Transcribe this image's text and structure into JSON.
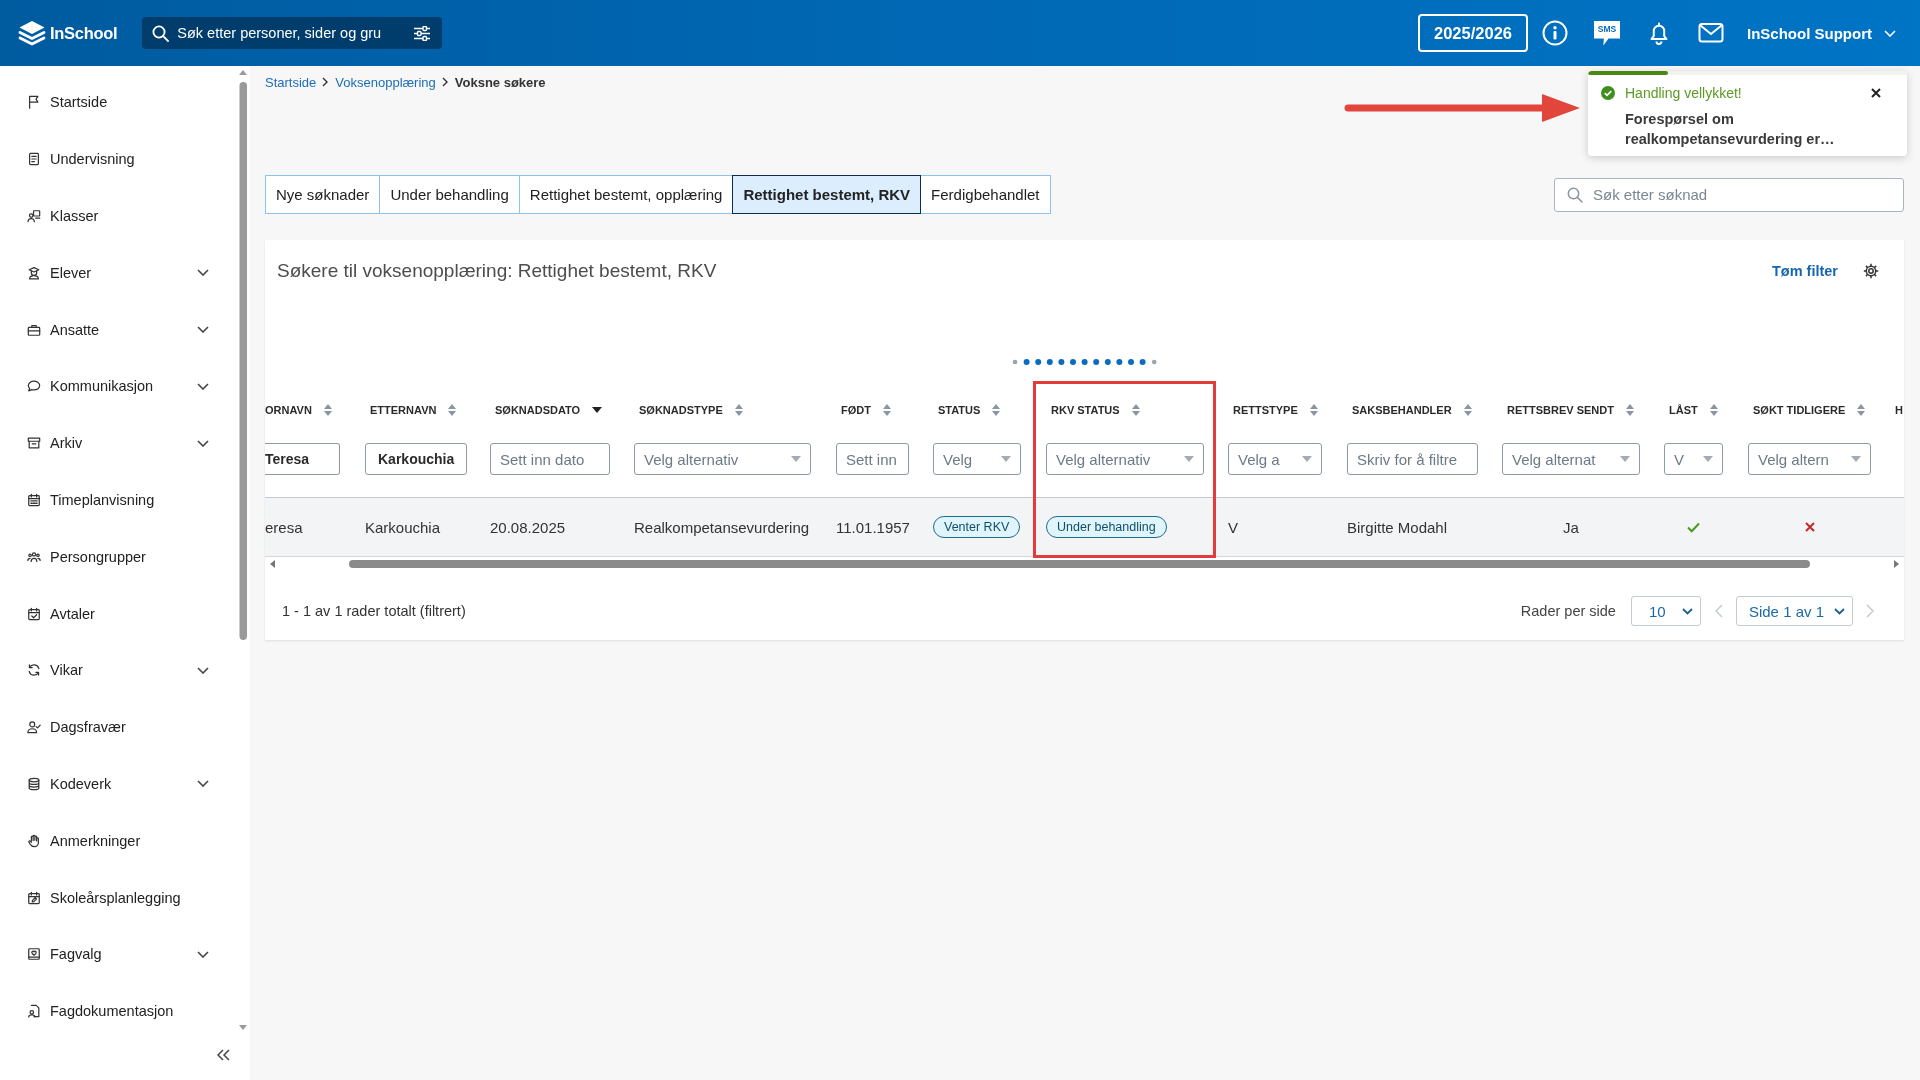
{
  "topbar": {
    "logo": "InSchool",
    "search": {
      "placeholder": "Søk etter personer, sider og gru"
    },
    "school_year": "2025/2026",
    "sms_label": "SMS",
    "user": "InSchool Support"
  },
  "sidebar": {
    "items": [
      {
        "label": "Startside",
        "expandable": false
      },
      {
        "label": "Undervisning",
        "expandable": false
      },
      {
        "label": "Klasser",
        "expandable": false
      },
      {
        "label": "Elever",
        "expandable": true
      },
      {
        "label": "Ansatte",
        "expandable": true
      },
      {
        "label": "Kommunikasjon",
        "expandable": true
      },
      {
        "label": "Arkiv",
        "expandable": true
      },
      {
        "label": "Timeplanvisning",
        "expandable": false
      },
      {
        "label": "Persongrupper",
        "expandable": false
      },
      {
        "label": "Avtaler",
        "expandable": false
      },
      {
        "label": "Vikar",
        "expandable": true
      },
      {
        "label": "Dagsfravær",
        "expandable": false
      },
      {
        "label": "Kodeverk",
        "expandable": true
      },
      {
        "label": "Anmerkninger",
        "expandable": false
      },
      {
        "label": "Skoleårsplanlegging",
        "expandable": false
      },
      {
        "label": "Fagvalg",
        "expandable": true
      },
      {
        "label": "Fagdokumentasjon",
        "expandable": false
      }
    ]
  },
  "breadcrumb": [
    {
      "label": "Startside",
      "current": false
    },
    {
      "label": "Voksenopplæring",
      "current": false
    },
    {
      "label": "Voksne søkere",
      "current": true
    }
  ],
  "toast": {
    "title": "Handling vellykket!",
    "message": "Forespørsel om realkompetansevurdering er…",
    "level": 0.25,
    "pointed_by_arrow": true
  },
  "tabs": [
    {
      "label": "Nye søknader",
      "selected": false
    },
    {
      "label": "Under behandling",
      "selected": false
    },
    {
      "label": "Rettighet bestemt, opplæring",
      "selected": false
    },
    {
      "label": "Rettighet bestemt, RKV",
      "selected": true
    },
    {
      "label": "Ferdigbehandlet",
      "selected": false
    }
  ],
  "application_search": {
    "placeholder": "Søk etter søknad"
  },
  "panel": {
    "title": "Søkere til voksenopplæring: Rettighet bestemt, RKV",
    "clear_filter": "Tøm filter",
    "loading": true
  },
  "table": {
    "columns": [
      {
        "label": "ORNAVN",
        "sorted": false,
        "highlighted": false,
        "filter": {
          "kind": "text",
          "value": "Teresa"
        }
      },
      {
        "label": "ETTERNAVN",
        "sorted": false,
        "highlighted": false,
        "filter": {
          "kind": "text",
          "value": "Karkouchia"
        }
      },
      {
        "label": "SØKNADSDATO",
        "sorted": true,
        "descending": true,
        "highlighted": false,
        "filter": {
          "kind": "text",
          "placeholder": "Sett inn dato"
        }
      },
      {
        "label": "SØKNADSTYPE",
        "sorted": false,
        "highlighted": false,
        "filter": {
          "kind": "select",
          "placeholder": "Velg alternativ"
        }
      },
      {
        "label": "FØDT",
        "sorted": false,
        "highlighted": false,
        "filter": {
          "kind": "text",
          "placeholder": "Sett inn"
        }
      },
      {
        "label": "STATUS",
        "sorted": false,
        "highlighted": false,
        "filter": {
          "kind": "select",
          "placeholder": "Velg"
        }
      },
      {
        "label": "RKV STATUS",
        "sorted": false,
        "highlighted": true,
        "filter": {
          "kind": "select",
          "placeholder": "Velg alternativ"
        }
      },
      {
        "label": "RETTSTYPE",
        "sorted": false,
        "highlighted": false,
        "filter": {
          "kind": "select",
          "placeholder": "Velg a"
        }
      },
      {
        "label": "SAKSBEHANDLER",
        "sorted": false,
        "highlighted": false,
        "filter": {
          "kind": "text",
          "placeholder": "Skriv for å filtre"
        }
      },
      {
        "label": "RETTSBREV SENDT",
        "sorted": false,
        "highlighted": false,
        "filter": {
          "kind": "select",
          "placeholder": "Velg alternat"
        }
      },
      {
        "label": "LÅST",
        "sorted": false,
        "highlighted": false,
        "filter": {
          "kind": "select",
          "placeholder": "V"
        }
      },
      {
        "label": "SØKT TIDLIGERE",
        "sorted": false,
        "highlighted": false,
        "filter": {
          "kind": "select",
          "placeholder": "Velg altern"
        }
      },
      {
        "label": "H",
        "highlighted": false
      }
    ],
    "rows": [
      {
        "cells": [
          {
            "kind": "text",
            "text": "eresa"
          },
          {
            "kind": "text",
            "text": "Karkouchia"
          },
          {
            "kind": "text",
            "text": "20.08.2025"
          },
          {
            "kind": "text",
            "text": "Realkompetansevurdering"
          },
          {
            "kind": "text",
            "text": "11.01.1957"
          },
          {
            "kind": "badge",
            "text": "Venter RKV"
          },
          {
            "kind": "badge",
            "text": "Under behandling"
          },
          {
            "kind": "text",
            "text": "V"
          },
          {
            "kind": "text",
            "text": "Birgitte Modahl"
          },
          {
            "kind": "text",
            "text": "Ja"
          },
          {
            "kind": "boolean",
            "checked": true
          },
          {
            "kind": "boolean",
            "checked": false
          }
        ]
      }
    ]
  },
  "pagination": {
    "summary": "1 - 1 av 1 rader totalt (filtrert)",
    "rows_per_page_label": "Rader per side",
    "rows_per_page": "10",
    "page": "Side 1 av 1",
    "previous_page": {
      "disabled": true
    },
    "next_page": {
      "disabled": true
    }
  }
}
